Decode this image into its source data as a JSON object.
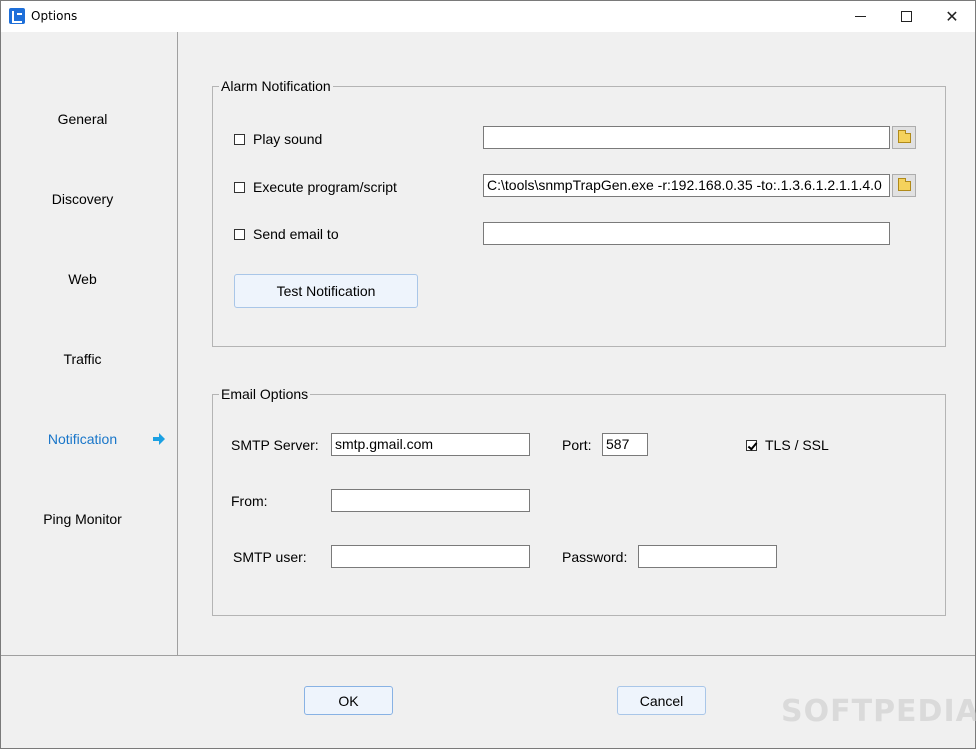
{
  "window": {
    "title": "Options",
    "app_icon": "network-map-icon"
  },
  "titlebar_buttons": [
    "minimize-icon",
    "maximize-icon",
    "close-icon"
  ],
  "sidebar": {
    "items": [
      {
        "label": "General"
      },
      {
        "label": "Discovery"
      },
      {
        "label": "Web"
      },
      {
        "label": "Traffic"
      },
      {
        "label": "Notification"
      },
      {
        "label": "Ping Monitor"
      }
    ],
    "active_index": 4,
    "active_color": "#1976c9",
    "arrow_color": "#1ba0e2"
  },
  "alarm": {
    "legend": "Alarm Notification",
    "play_sound": {
      "label": "Play sound",
      "checked": false,
      "value": ""
    },
    "execute": {
      "label": "Execute program/script",
      "checked": false,
      "value": "C:\\tools\\snmpTrapGen.exe -r:192.168.0.35 -to:.1.3.6.1.2.1.1.4.0"
    },
    "send_email": {
      "label": "Send email to",
      "checked": false,
      "value": ""
    },
    "test_button": "Test Notification"
  },
  "email": {
    "legend": "Email Options",
    "smtp_server_label": "SMTP Server:",
    "smtp_server_value": "smtp.gmail.com",
    "port_label": "Port:",
    "port_value": "587",
    "tls_label": "TLS / SSL",
    "tls_checked": true,
    "from_label": "From:",
    "from_value": "",
    "smtp_user_label": "SMTP user:",
    "smtp_user_value": "",
    "password_label": "Password:",
    "password_value": ""
  },
  "footer": {
    "ok_label": "OK",
    "cancel_label": "Cancel"
  },
  "watermark": "SOFTPEDIA®"
}
